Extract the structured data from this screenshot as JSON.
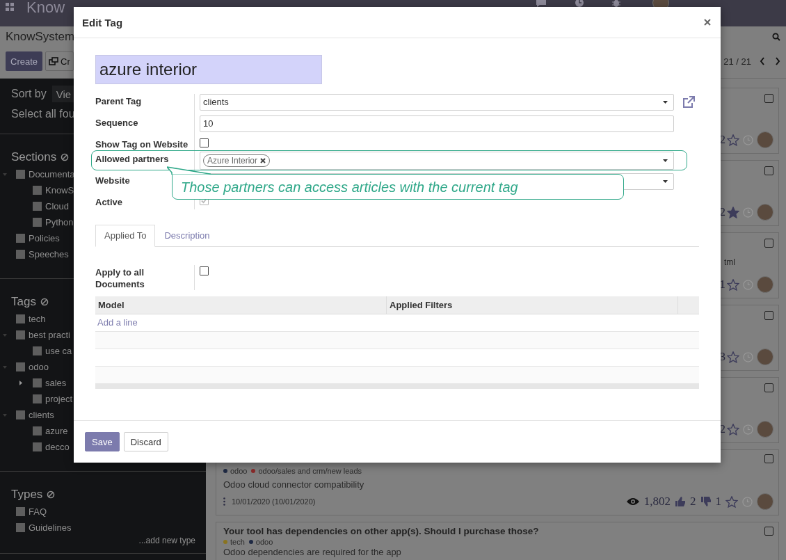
{
  "navbar": {
    "app_name": "Know"
  },
  "control_panel": {
    "breadcrumb": "KnowSystem",
    "create": "Create",
    "second_button": "Cr",
    "pager": "21 / 21"
  },
  "sidebar": {
    "sort_label": "Sort by",
    "sort_button": "Vie",
    "select_all": "Select all fou",
    "groups": [
      {
        "title": "Sections",
        "items": [
          {
            "label": "Documenta",
            "checked": false,
            "expanded": true,
            "children": [
              {
                "label": "KnowS",
                "checked": false
              },
              {
                "label": "Cloud",
                "checked": false
              },
              {
                "label": "Python",
                "checked": false
              }
            ]
          },
          {
            "label": "Policies",
            "checked": false
          },
          {
            "label": "Speeches",
            "checked": false
          }
        ]
      },
      {
        "title": "Tags",
        "items": [
          {
            "label": "tech",
            "checked": false
          },
          {
            "label": "best practi",
            "checked": false,
            "expanded": true,
            "children": [
              {
                "label": "use ca",
                "checked": false
              }
            ]
          },
          {
            "label": "odoo",
            "checked": false,
            "expanded": true,
            "children": [
              {
                "label": "sales",
                "checked": false,
                "expanded": false
              },
              {
                "label": "project",
                "checked": false
              }
            ]
          },
          {
            "label": "clients",
            "checked": false,
            "expanded": true,
            "children": [
              {
                "label": "azure",
                "checked": false
              },
              {
                "label": "decco",
                "checked": false
              }
            ]
          }
        ]
      },
      {
        "title": "Types",
        "items": [
          {
            "label": "FAQ",
            "checked": false
          },
          {
            "label": "Guidelines",
            "checked": false
          }
        ],
        "add_link": "...add new type"
      }
    ]
  },
  "articles": [
    {
      "kind": "summary",
      "count": "2",
      "starred": false,
      "checked": false
    },
    {
      "kind": "summary",
      "count": "2",
      "starred": true,
      "checked": false
    },
    {
      "kind": "summary",
      "fragment": "tml",
      "count": "1",
      "starred": false,
      "checked": false
    },
    {
      "kind": "summary",
      "count": "3",
      "starred": false,
      "checked": false
    },
    {
      "kind": "summary",
      "count": "2",
      "starred": false,
      "checked": false
    },
    {
      "kind": "detail",
      "checked": false,
      "tags": [
        {
          "label": "odoo",
          "color": "#1f2a44"
        },
        {
          "label": "odoo/sales and crm/new leads",
          "color": "#8a2b2b"
        }
      ],
      "description": "Odoo cloud connector compatibility",
      "date": "10/01/2020 (10/01/2020)",
      "views": "1,802",
      "likes": "2",
      "dislikes": "1",
      "starred": false
    },
    {
      "kind": "headline",
      "checked": false,
      "title": "Your tool has dependencies on other app(s). Should I purchase those?",
      "tags": [
        {
          "label": "tech",
          "color": "#8a7420"
        },
        {
          "label": "odoo",
          "color": "#1f2a44"
        }
      ],
      "description": "Odoo dependencies are required for the app"
    }
  ],
  "dialog": {
    "title": "Edit Tag",
    "name": "azure interior",
    "fields": [
      {
        "kind": "select",
        "label": "Parent Tag",
        "value": "clients",
        "external_link": true
      },
      {
        "kind": "text",
        "label": "Sequence",
        "value": "10"
      },
      {
        "kind": "checkbox",
        "label": "Show Tag on Website",
        "checked": false
      },
      {
        "kind": "tags",
        "label": "Allowed partners",
        "tags": [
          "Azure Interior"
        ]
      },
      {
        "kind": "select",
        "label": "Website"
      },
      {
        "kind": "checkbox",
        "label": "Active",
        "checked": true
      }
    ],
    "tabs": [
      {
        "label": "Applied To",
        "selected": true
      },
      {
        "label": "Description",
        "selected": false
      }
    ],
    "apply_all": {
      "label": "Apply to all Documents",
      "checked": false
    },
    "table": {
      "columns": [
        "Model",
        "Applied Filters"
      ],
      "add_line": "Add a line"
    },
    "buttons": [
      "Save",
      "Discard"
    ]
  },
  "callout": {
    "text": "Those partners can access articles with the current tag"
  }
}
